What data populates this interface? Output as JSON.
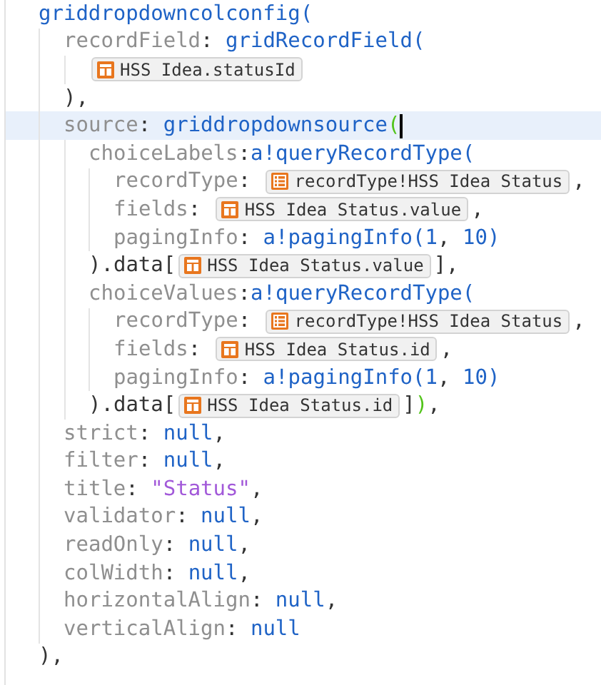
{
  "editor": {
    "lines": [
      {
        "tokens": [
          {
            "kind": "func",
            "text": "griddropdowncolconfig("
          }
        ],
        "children": [
          {
            "tokens": [
              {
                "kind": "key",
                "text": "recordField"
              },
              {
                "kind": "punct",
                "text": ": "
              },
              {
                "kind": "func",
                "text": "gridRecordField("
              }
            ],
            "children": [
              {
                "tokens": [
                  {
                    "kind": "field_chip",
                    "text": "HSS Idea.statusId"
                  }
                ]
              }
            ]
          },
          {
            "tokens": [
              {
                "kind": "punct",
                "text": "),"
              }
            ]
          },
          {
            "tokens": [
              {
                "kind": "key",
                "text": "source"
              },
              {
                "kind": "punct",
                "text": ": "
              },
              {
                "kind": "func",
                "text": "griddropdownsource"
              },
              {
                "kind": "bracket",
                "text": "(",
                "matched": true
              }
            ],
            "current": true,
            "children": [
              {
                "tokens": [
                  {
                    "kind": "key",
                    "text": "choiceLabels"
                  },
                  {
                    "kind": "punct",
                    "text": ":"
                  },
                  {
                    "kind": "func",
                    "text": "a!queryRecordType("
                  }
                ],
                "children": [
                  {
                    "tokens": [
                      {
                        "kind": "key",
                        "text": "recordType"
                      },
                      {
                        "kind": "punct",
                        "text": ": "
                      },
                      {
                        "kind": "record_chip",
                        "text": "recordType!HSS Idea Status"
                      },
                      {
                        "kind": "punct",
                        "text": ","
                      }
                    ]
                  },
                  {
                    "tokens": [
                      {
                        "kind": "key",
                        "text": "fields"
                      },
                      {
                        "kind": "punct",
                        "text": ": "
                      },
                      {
                        "kind": "field_chip",
                        "text": "HSS Idea Status.value"
                      },
                      {
                        "kind": "punct",
                        "text": ","
                      }
                    ]
                  },
                  {
                    "tokens": [
                      {
                        "kind": "key",
                        "text": "pagingInfo"
                      },
                      {
                        "kind": "punct",
                        "text": ": "
                      },
                      {
                        "kind": "func",
                        "text": "a!pagingInfo("
                      },
                      {
                        "kind": "number",
                        "text": "1"
                      },
                      {
                        "kind": "punct",
                        "text": ", "
                      },
                      {
                        "kind": "number",
                        "text": "10"
                      },
                      {
                        "kind": "func",
                        "text": ")"
                      }
                    ]
                  }
                ]
              },
              {
                "tokens": [
                  {
                    "kind": "punct",
                    "text": ").data["
                  },
                  {
                    "kind": "field_chip",
                    "text": "HSS Idea Status.value"
                  },
                  {
                    "kind": "punct",
                    "text": "],"
                  }
                ]
              },
              {
                "tokens": [
                  {
                    "kind": "key",
                    "text": "choiceValues"
                  },
                  {
                    "kind": "punct",
                    "text": ":"
                  },
                  {
                    "kind": "func",
                    "text": "a!queryRecordType("
                  }
                ],
                "children": [
                  {
                    "tokens": [
                      {
                        "kind": "key",
                        "text": "recordType"
                      },
                      {
                        "kind": "punct",
                        "text": ": "
                      },
                      {
                        "kind": "record_chip",
                        "text": "recordType!HSS Idea Status"
                      },
                      {
                        "kind": "punct",
                        "text": ","
                      }
                    ]
                  },
                  {
                    "tokens": [
                      {
                        "kind": "key",
                        "text": "fields"
                      },
                      {
                        "kind": "punct",
                        "text": ": "
                      },
                      {
                        "kind": "field_chip",
                        "text": "HSS Idea Status.id"
                      },
                      {
                        "kind": "punct",
                        "text": ","
                      }
                    ]
                  },
                  {
                    "tokens": [
                      {
                        "kind": "key",
                        "text": "pagingInfo"
                      },
                      {
                        "kind": "punct",
                        "text": ": "
                      },
                      {
                        "kind": "func",
                        "text": "a!pagingInfo("
                      },
                      {
                        "kind": "number",
                        "text": "1"
                      },
                      {
                        "kind": "punct",
                        "text": ", "
                      },
                      {
                        "kind": "number",
                        "text": "10"
                      },
                      {
                        "kind": "func",
                        "text": ")"
                      }
                    ]
                  }
                ]
              },
              {
                "tokens": [
                  {
                    "kind": "punct",
                    "text": ").data["
                  },
                  {
                    "kind": "field_chip",
                    "text": "HSS Idea Status.id"
                  },
                  {
                    "kind": "punct",
                    "text": "]"
                  },
                  {
                    "kind": "bracket",
                    "text": ")",
                    "matched": true
                  },
                  {
                    "kind": "punct",
                    "text": ","
                  }
                ]
              }
            ]
          },
          {
            "tokens": [
              {
                "kind": "key",
                "text": "strict"
              },
              {
                "kind": "punct",
                "text": ": "
              },
              {
                "kind": "null",
                "text": "null"
              },
              {
                "kind": "punct",
                "text": ","
              }
            ]
          },
          {
            "tokens": [
              {
                "kind": "key",
                "text": "filter"
              },
              {
                "kind": "punct",
                "text": ": "
              },
              {
                "kind": "null",
                "text": "null"
              },
              {
                "kind": "punct",
                "text": ","
              }
            ]
          },
          {
            "tokens": [
              {
                "kind": "key",
                "text": "title"
              },
              {
                "kind": "punct",
                "text": ": "
              },
              {
                "kind": "string",
                "text": "\"Status\""
              },
              {
                "kind": "punct",
                "text": ","
              }
            ]
          },
          {
            "tokens": [
              {
                "kind": "key",
                "text": "validator"
              },
              {
                "kind": "punct",
                "text": ": "
              },
              {
                "kind": "null",
                "text": "null"
              },
              {
                "kind": "punct",
                "text": ","
              }
            ]
          },
          {
            "tokens": [
              {
                "kind": "key",
                "text": "readOnly"
              },
              {
                "kind": "punct",
                "text": ": "
              },
              {
                "kind": "null",
                "text": "null"
              },
              {
                "kind": "punct",
                "text": ","
              }
            ]
          },
          {
            "tokens": [
              {
                "kind": "key",
                "text": "colWidth"
              },
              {
                "kind": "punct",
                "text": ": "
              },
              {
                "kind": "null",
                "text": "null"
              },
              {
                "kind": "punct",
                "text": ","
              }
            ]
          },
          {
            "tokens": [
              {
                "kind": "key",
                "text": "horizontalAlign"
              },
              {
                "kind": "punct",
                "text": ": "
              },
              {
                "kind": "null",
                "text": "null"
              },
              {
                "kind": "punct",
                "text": ","
              }
            ]
          },
          {
            "tokens": [
              {
                "kind": "key",
                "text": "verticalAlign"
              },
              {
                "kind": "punct",
                "text": ": "
              },
              {
                "kind": "null",
                "text": "null"
              }
            ]
          }
        ]
      },
      {
        "tokens": [
          {
            "kind": "punct",
            "text": "),"
          }
        ]
      }
    ]
  }
}
